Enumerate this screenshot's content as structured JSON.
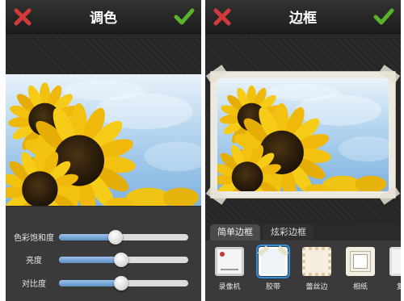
{
  "left_screen": {
    "title": "调色",
    "sliders": [
      {
        "label": "色彩饱和度",
        "level_percent": 44
      },
      {
        "label": "亮度",
        "level_percent": 48
      },
      {
        "label": "对比度",
        "level_percent": 48
      }
    ]
  },
  "right_screen": {
    "title": "边框",
    "tabs": [
      "简单边框",
      "炫彩边框"
    ],
    "active_tab": "简单边框",
    "frames": [
      {
        "label": "录像机"
      },
      {
        "label": "胶带",
        "selected": true
      },
      {
        "label": "蕾丝边"
      },
      {
        "label": "相纸"
      },
      {
        "label": "复古"
      }
    ]
  },
  "icons": {
    "cancel": "close-x-icon",
    "confirm": "checkmark-icon"
  },
  "colors": {
    "cancel_red": "#d23a3a",
    "confirm_green": "#5ab22a",
    "slider_fill": "#6b9bd0",
    "selection": "#2f8fe0"
  }
}
